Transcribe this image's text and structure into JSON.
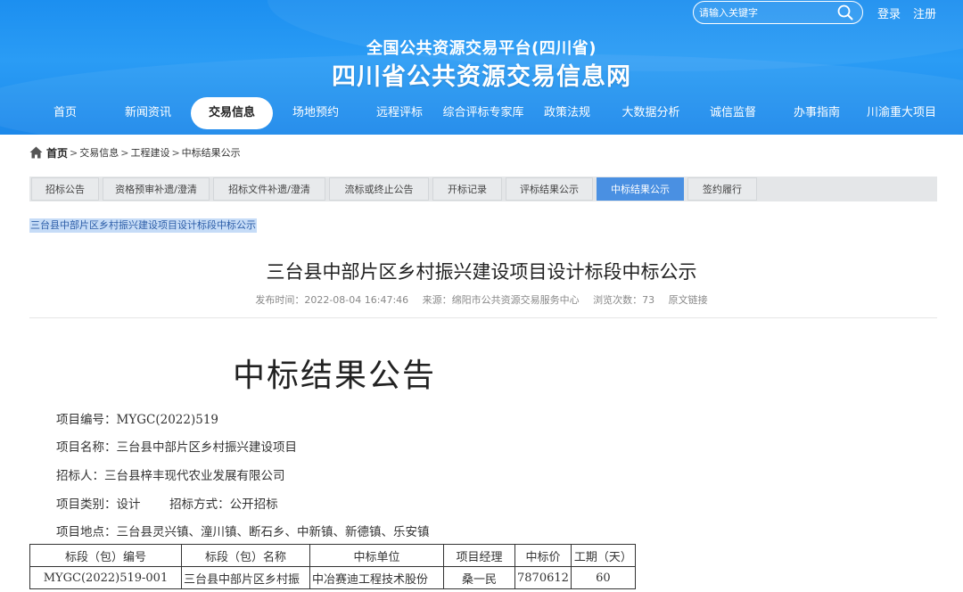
{
  "header": {
    "search_placeholder": "请输入关键字",
    "login": "登录",
    "register": "注册",
    "platform_title": "全国公共资源交易平台(四川省)",
    "site_title": "四川省公共资源交易信息网",
    "nav": [
      "首页",
      "新闻资讯",
      "交易信息",
      "场地预约",
      "远程评标",
      "综合评标专家库",
      "政策法规",
      "大数据分析",
      "诚信监督",
      "办事指南",
      "川渝重大项目"
    ],
    "active_nav": "交易信息"
  },
  "breadcrumb": {
    "home": "首页",
    "items": [
      "交易信息",
      "工程建设",
      "中标结果公示"
    ],
    "separator": ">"
  },
  "subtabs": [
    "招标公告",
    "资格预审补遗/澄清",
    "招标文件补遗/澄清",
    "流标或终止公告",
    "开标记录",
    "评标结果公示",
    "中标结果公示",
    "签约履行"
  ],
  "active_subtab": "中标结果公示",
  "selected_link": "三台县中部片区乡村振兴建设项目设计标段中标公示",
  "article": {
    "title": "三台县中部片区乡村振兴建设项目设计标段中标公示",
    "publish_time": "发布时间：2022-08-04 16:47:46",
    "source": "来源：绵阳市公共资源交易服务中心",
    "views": "浏览次数：73",
    "original_link": "原文链接",
    "notice_heading": "中标结果公告",
    "project_no": "项目编号：MYGC(2022)519",
    "project_name": "项目名称：三台县中部片区乡村振兴建设项目",
    "tenderer": "招标人：三台县梓丰现代农业发展有限公司",
    "project_type": "项目类别：设计",
    "bid_method": "招标方式：公开招标",
    "location": "项目地点：三台县灵兴镇、潼川镇、断石乡、中新镇、新德镇、乐安镇"
  },
  "result_table": {
    "headers": [
      "标段（包）编号",
      "标段（包）名称",
      "中标单位",
      "项目经理",
      "中标价",
      "工期（天）"
    ],
    "rows": [
      [
        "MYGC(2022)519-001",
        "三台县中部片区乡村振",
        "中冶赛迪工程技术股份",
        "桑一民",
        "7870612",
        "60"
      ]
    ]
  },
  "colors": {
    "header_blue": "#1c8ff0",
    "active_subtab": "#4a90e2",
    "selection_highlight": "#c6dcf7"
  }
}
